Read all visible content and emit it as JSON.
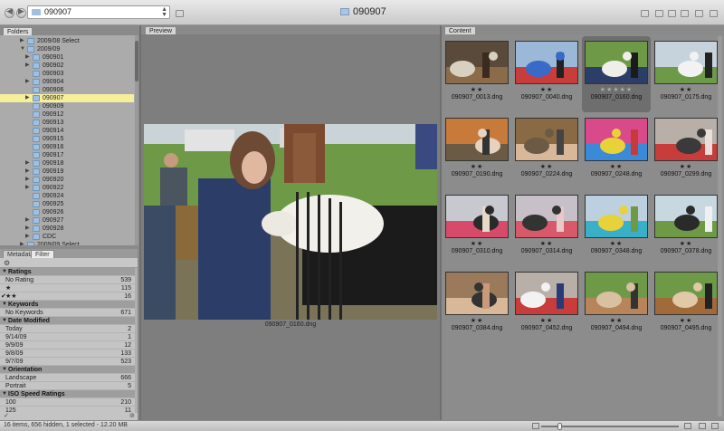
{
  "window": {
    "title": "090907",
    "path_value": "090907"
  },
  "folders_panel": {
    "tab_label": "Folders",
    "items": [
      {
        "label": "2009/08 Select",
        "level": 1,
        "expanded": false
      },
      {
        "label": "2009/09",
        "level": 1,
        "expanded": true
      },
      {
        "label": "090901",
        "level": 2,
        "expandable": true
      },
      {
        "label": "090902",
        "level": 2,
        "expandable": true
      },
      {
        "label": "090903",
        "level": 2,
        "expandable": false
      },
      {
        "label": "090904",
        "level": 2,
        "expandable": true
      },
      {
        "label": "090906",
        "level": 2,
        "expandable": false
      },
      {
        "label": "090907",
        "level": 2,
        "expandable": true,
        "selected": true
      },
      {
        "label": "090909",
        "level": 2,
        "expandable": false
      },
      {
        "label": "090912",
        "level": 2,
        "expandable": false
      },
      {
        "label": "090913",
        "level": 2,
        "expandable": false
      },
      {
        "label": "090914",
        "level": 2,
        "expandable": false
      },
      {
        "label": "090915",
        "level": 2,
        "expandable": false
      },
      {
        "label": "090916",
        "level": 2,
        "expandable": false
      },
      {
        "label": "090917",
        "level": 2,
        "expandable": false
      },
      {
        "label": "090918",
        "level": 2,
        "expandable": true
      },
      {
        "label": "090919",
        "level": 2,
        "expandable": true
      },
      {
        "label": "090920",
        "level": 2,
        "expandable": true
      },
      {
        "label": "090922",
        "level": 2,
        "expandable": true
      },
      {
        "label": "090924",
        "level": 2,
        "expandable": false
      },
      {
        "label": "090925",
        "level": 2,
        "expandable": false
      },
      {
        "label": "090926",
        "level": 2,
        "expandable": false
      },
      {
        "label": "090927",
        "level": 2,
        "expandable": true
      },
      {
        "label": "090928",
        "level": 2,
        "expandable": true
      },
      {
        "label": "CDC",
        "level": 2,
        "expandable": true
      },
      {
        "label": "2009/09 Select",
        "level": 1,
        "expanded": false
      }
    ]
  },
  "filter_panel": {
    "tabs": [
      "Metadata",
      "Filter"
    ],
    "active_tab": "Filter",
    "groups": [
      {
        "title": "Ratings",
        "rows": [
          {
            "label": "No Rating",
            "count": "539",
            "checked": false
          },
          {
            "label": "★",
            "count": "115",
            "checked": false
          },
          {
            "label": "★★",
            "count": "16",
            "checked": true
          }
        ]
      },
      {
        "title": "Keywords",
        "rows": [
          {
            "label": "No Keywords",
            "count": "671",
            "checked": false
          }
        ]
      },
      {
        "title": "Date Modified",
        "rows": [
          {
            "label": "Today",
            "count": "2",
            "checked": false
          },
          {
            "label": "9/14/09",
            "count": "1",
            "checked": false
          },
          {
            "label": "9/9/09",
            "count": "12",
            "checked": false
          },
          {
            "label": "9/8/09",
            "count": "133",
            "checked": false
          },
          {
            "label": "9/7/09",
            "count": "523",
            "checked": false
          }
        ]
      },
      {
        "title": "Orientation",
        "rows": [
          {
            "label": "Landscape",
            "count": "666",
            "checked": false
          },
          {
            "label": "Portrait",
            "count": "5",
            "checked": false
          }
        ]
      },
      {
        "title": "ISO Speed Ratings",
        "rows": [
          {
            "label": "100",
            "count": "210",
            "checked": false
          },
          {
            "label": "125",
            "count": "11",
            "checked": false
          }
        ]
      }
    ]
  },
  "preview_panel": {
    "tab_label": "Preview",
    "caption": "090907_0160.dng"
  },
  "content_panel": {
    "tab_label": "Content",
    "items": [
      {
        "name": "090907_0013.dng",
        "stars": "★★",
        "scene": "barn",
        "selected": false
      },
      {
        "name": "090907_0040.dng",
        "stars": "★★",
        "scene": "fair",
        "selected": false
      },
      {
        "name": "090907_0160.dng",
        "stars": "★★★★★",
        "scene": "goat",
        "selected": true
      },
      {
        "name": "090907_0175.dng",
        "stars": "★★",
        "scene": "field",
        "selected": false
      },
      {
        "name": "090907_0190.dng",
        "stars": "★★",
        "scene": "pen",
        "selected": false
      },
      {
        "name": "090907_0224.dng",
        "stars": "★★",
        "scene": "pigs",
        "selected": false
      },
      {
        "name": "090907_0248.dng",
        "stars": "★★",
        "scene": "ride",
        "selected": false
      },
      {
        "name": "090907_0299.dng",
        "stars": "★★",
        "scene": "pen2",
        "selected": false
      },
      {
        "name": "090907_0310.dng",
        "stars": "★★",
        "scene": "cups",
        "selected": false
      },
      {
        "name": "090907_0314.dng",
        "stars": "★★",
        "scene": "cups2",
        "selected": false
      },
      {
        "name": "090907_0348.dng",
        "stars": "★★",
        "scene": "carousel",
        "selected": false
      },
      {
        "name": "090907_0378.dng",
        "stars": "★★",
        "scene": "cows",
        "selected": false
      },
      {
        "name": "090907_0384.dng",
        "stars": "★★",
        "scene": "cups3",
        "selected": false
      },
      {
        "name": "090907_0452.dng",
        "stars": "★★",
        "scene": "flag",
        "selected": false
      },
      {
        "name": "090907_0494.dng",
        "stars": "★★",
        "scene": "goats",
        "selected": false
      },
      {
        "name": "090907_0495.dng",
        "stars": "★★",
        "scene": "goats2",
        "selected": false
      }
    ]
  },
  "status_bar": {
    "text": "16 items, 656 hidden, 1 selected - 12.20 MB"
  }
}
